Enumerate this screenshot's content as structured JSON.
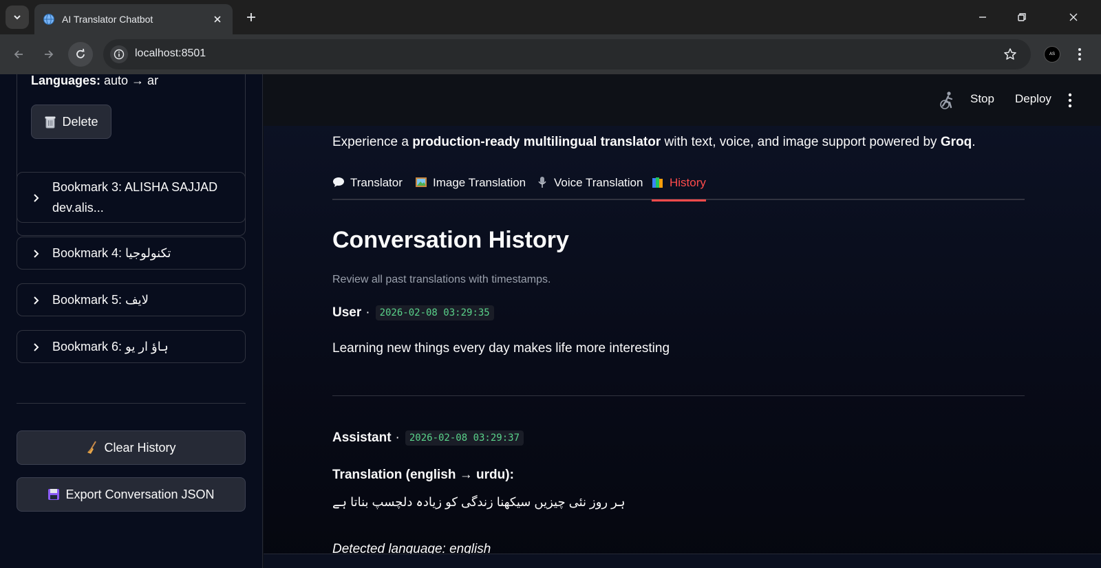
{
  "browser": {
    "tab_title": "AI Translator Chatbot",
    "url": "localhost:8501",
    "profile_initials": "AS"
  },
  "sidebar": {
    "languages_label": "Languages:",
    "languages_value": " auto → ar",
    "delete_label": "Delete",
    "bookmarks": [
      {
        "label": "Bookmark 3: ALISHA SAJJAD dev.alis..."
      },
      {
        "label": "Bookmark 4: تکنولوجیا"
      },
      {
        "label": "Bookmark 5: لایف"
      },
      {
        "label": "Bookmark 6: ہاؤ ار یو"
      }
    ],
    "clear_history_label": "Clear History",
    "export_label": "Export Conversation JSON"
  },
  "header": {
    "stop_label": "Stop",
    "deploy_label": "Deploy"
  },
  "main": {
    "intro_prefix": "Experience a ",
    "intro_bold": "production-ready multilingual translator",
    "intro_middle": " with text, voice, and image support powered by ",
    "intro_brand": "Groq",
    "intro_suffix": ".",
    "tabs": [
      {
        "label": "Translator",
        "icon": "speech-balloon"
      },
      {
        "label": "Image Translation",
        "icon": "framed-picture"
      },
      {
        "label": "Voice Translation",
        "icon": "microphone"
      },
      {
        "label": "History",
        "icon": "books",
        "active": true
      }
    ],
    "heading": "Conversation History",
    "caption": "Review all past translations with timestamps.",
    "messages": [
      {
        "role": "User",
        "sep": " ·",
        "timestamp": "2026-02-08 03:29:35",
        "text": "Learning new things every day makes life more interesting"
      },
      {
        "role": "Assistant",
        "sep": " ·",
        "timestamp": "2026-02-08 03:29:37",
        "translation_title": "Translation (english → urdu):",
        "translation": "ہر روز نئی چیزیں سیکھنا زندگی کو زیادہ دلچسپ بناتا ہے",
        "detected": "Detected language: english"
      }
    ]
  },
  "colors": {
    "accent": "#ff4b4b",
    "timestamp": "#5ad28a",
    "sidebar_bg": "#080d1d"
  }
}
